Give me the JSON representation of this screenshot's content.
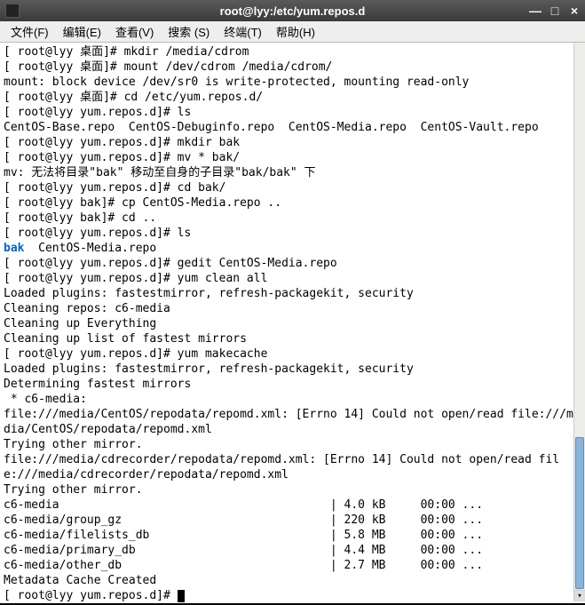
{
  "titlebar": {
    "title": "root@lyy:/etc/yum.repos.d"
  },
  "menubar": {
    "file": "文件(F)",
    "edit": "编辑(E)",
    "view": "查看(V)",
    "search": "搜索 (S)",
    "terminal": "终端(T)",
    "help": "帮助(H)"
  },
  "lines": [
    {
      "t": "[ root@lyy 桌面]# mkdir /media/cdrom"
    },
    {
      "t": "[ root@lyy 桌面]# mount /dev/cdrom /media/cdrom/"
    },
    {
      "t": "mount: block device /dev/sr0 is write-protected, mounting read-only"
    },
    {
      "t": "[ root@lyy 桌面]# cd /etc/yum.repos.d/"
    },
    {
      "t": "[ root@lyy yum.repos.d]# ls"
    },
    {
      "t": "CentOS-Base.repo  CentOS-Debuginfo.repo  CentOS-Media.repo  CentOS-Vault.repo"
    },
    {
      "t": "[ root@lyy yum.repos.d]# mkdir bak"
    },
    {
      "t": "[ root@lyy yum.repos.d]# mv * bak/"
    },
    {
      "t": "mv: 无法将目录\"bak\" 移动至自身的子目录\"bak/bak\" 下"
    },
    {
      "t": "[ root@lyy yum.repos.d]# cd bak/"
    },
    {
      "t": "[ root@lyy bak]# cp CentOS-Media.repo .."
    },
    {
      "t": "[ root@lyy bak]# cd .."
    },
    {
      "t": "[ root@lyy yum.repos.d]# ls"
    },
    {
      "dir": "bak",
      "rest": "  CentOS-Media.repo"
    },
    {
      "t": "[ root@lyy yum.repos.d]# gedit CentOS-Media.repo"
    },
    {
      "t": "[ root@lyy yum.repos.d]# yum clean all"
    },
    {
      "t": "Loaded plugins: fastestmirror, refresh-packagekit, security"
    },
    {
      "t": "Cleaning repos: c6-media"
    },
    {
      "t": "Cleaning up Everything"
    },
    {
      "t": "Cleaning up list of fastest mirrors"
    },
    {
      "t": "[ root@lyy yum.repos.d]# yum makecache"
    },
    {
      "t": "Loaded plugins: fastestmirror, refresh-packagekit, security"
    },
    {
      "t": "Determining fastest mirrors"
    },
    {
      "t": " * c6-media:"
    },
    {
      "t": "file:///media/CentOS/repodata/repomd.xml: [Errno 14] Could not open/read file:///media/CentOS/repodata/repomd.xml"
    },
    {
      "t": "Trying other mirror."
    },
    {
      "t": "file:///media/cdrecorder/repodata/repomd.xml: [Errno 14] Could not open/read file:///media/cdrecorder/repodata/repomd.xml"
    },
    {
      "t": "Trying other mirror."
    },
    {
      "t": "c6-media                                       | 4.0 kB     00:00 ..."
    },
    {
      "t": "c6-media/group_gz                              | 220 kB     00:00 ..."
    },
    {
      "t": "c6-media/filelists_db                          | 5.8 MB     00:00 ..."
    },
    {
      "t": "c6-media/primary_db                            | 4.4 MB     00:00 ..."
    },
    {
      "t": "c6-media/other_db                              | 2.7 MB     00:00 ..."
    },
    {
      "t": "Metadata Cache Created"
    },
    {
      "prompt": "[ root@lyy yum.repos.d]# "
    }
  ]
}
